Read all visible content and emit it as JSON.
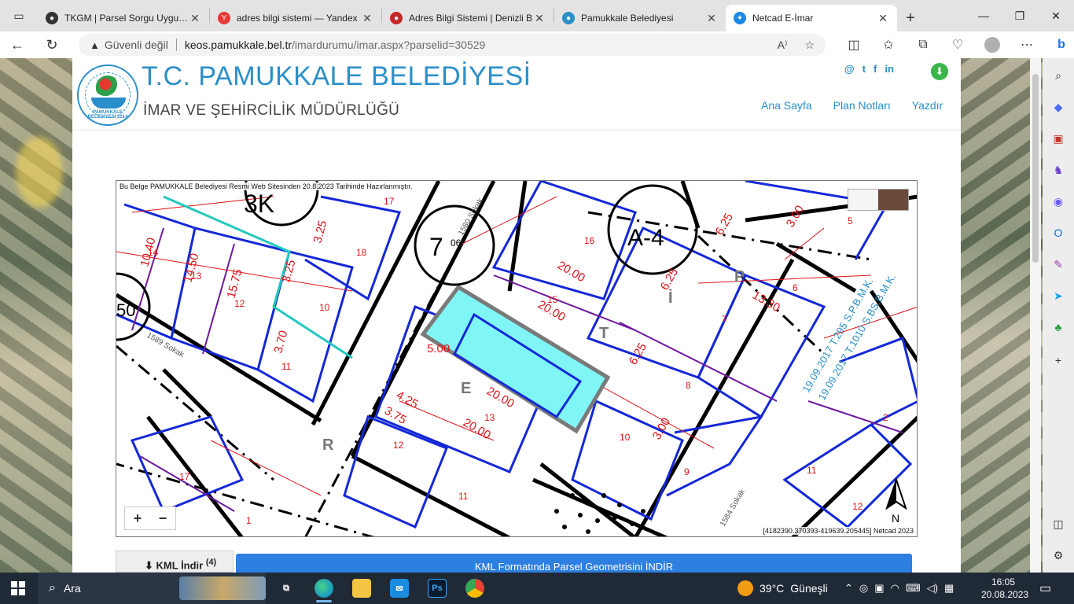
{
  "browser": {
    "tabs": [
      {
        "title": "TKGM | Parsel Sorgu Uygulam",
        "icon_color": "#333333",
        "icon": "pin-icon"
      },
      {
        "title": "adres bilgi sistemi — Yandex",
        "icon_color": "#e53935",
        "icon": "yandex-icon"
      },
      {
        "title": "Adres Bilgi Sistemi | Denizli B",
        "icon_color": "#c62828",
        "icon": "denizli-icon"
      },
      {
        "title": "Pamukkale Belediyesi",
        "icon_color": "#2a8fc9",
        "icon": "pamukkale-icon"
      },
      {
        "title": "Netcad E-İmar",
        "icon_color": "#1e88e5",
        "icon": "netcad-icon"
      }
    ],
    "security_label": "Güvenli değil",
    "url_host": "keos.pamukkale.bel.tr",
    "url_path": "/imardurumu/imar.aspx?parselid=30529"
  },
  "header": {
    "title": "T.C. PAMUKKALE BELEDİYESİ",
    "subtitle": "İMAR VE ŞEHİRCİLİK MÜDÜRLÜĞÜ",
    "logo_text": "PAMUKKALE BELEDİYESİ",
    "logo_year": "2014",
    "social": [
      "@",
      "t",
      "f",
      "in"
    ],
    "nav": [
      "Ana Sayfa",
      "Plan Notları",
      "Yazdır"
    ]
  },
  "map": {
    "note": "Bu Belge PAMUKKALE Belediyesi Resmi Web Sitesinden 20.8.2023 Tarihinde Hazırlanmıştır.",
    "coords": "[4182390.370393-419639.205445] Netcad 2023",
    "zoom_in": "+",
    "zoom_out": "−",
    "north": "N",
    "labels": {
      "zone_3k": "3K",
      "zone_7": "7",
      "zone_7_sub": "06",
      "zone_a4": "A-4",
      "zone_50": "50",
      "street_1": "1589 Sokak",
      "street_2": "1584 Sokak",
      "street_3": "1580 Sokak",
      "vertical_1": "19.09.2017 T.295 S.P.B.M.K.",
      "vertical_2": "19.09.2017 T.1010 S.BS.B.M.K."
    }
  },
  "kml": {
    "label": "KML İndir",
    "label_sup": "(4)",
    "button": "KML Formatında Parsel Geometrisini İNDİR"
  },
  "taskbar": {
    "search": "Ara",
    "weather_temp": "39°C",
    "weather_desc": "Güneşli",
    "time": "16:05",
    "date": "20.08.2023"
  },
  "colors": {
    "brand": "#2a8fc9",
    "parcel_highlight": "#7ff5f5",
    "kml_button": "#2d7fe0"
  }
}
